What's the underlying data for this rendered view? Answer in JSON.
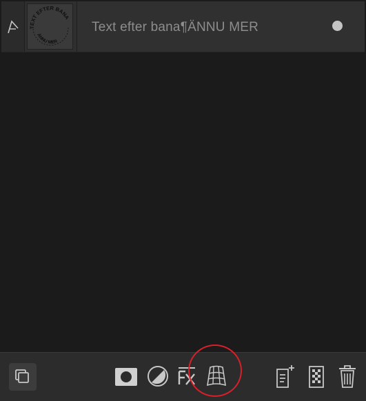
{
  "layer": {
    "name": "Text efter bana¶ÄNNU MER",
    "thumbnail_text_top": "TEXT EFTER BANA",
    "thumbnail_text_bottom": "ÄNNU MER"
  },
  "icons": {
    "layer_type": "path-text-icon",
    "visibility": "visibility-dot-icon",
    "layers": "layers-stack-icon",
    "mask": "mask-icon",
    "adjustment": "adjustment-icon",
    "fx": "fx-icon",
    "warp": "warp-mesh-icon",
    "add_layer": "add-layer-icon",
    "pixel_layer": "pixel-layer-icon",
    "delete": "trash-icon"
  },
  "colors": {
    "panel_bg": "#1b1b1b",
    "row_bg": "#303030",
    "toolbar_bg": "#2c2c2c",
    "icon": "#c8c8c8",
    "highlight": "#d9202a"
  }
}
